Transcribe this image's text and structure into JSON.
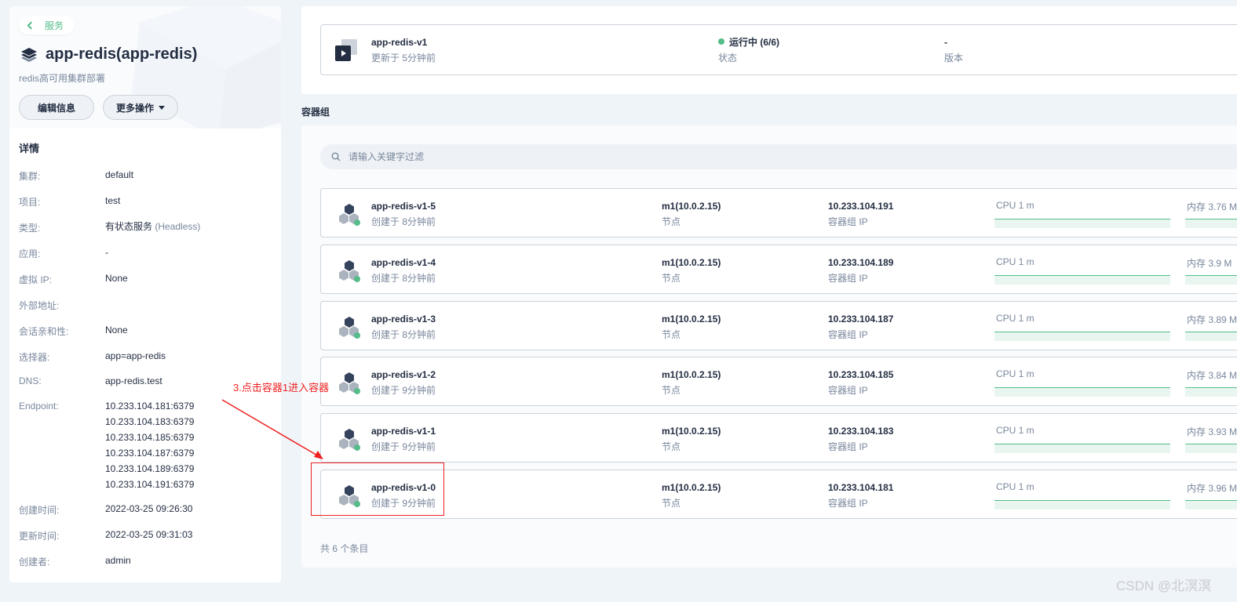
{
  "sidebar": {
    "back_label": "服务",
    "title": "app-redis(app-redis)",
    "subtitle": "redis高可用集群部署",
    "edit_button": "编辑信息",
    "more_button": "更多操作",
    "details_title": "详情",
    "details": [
      {
        "key": "集群:",
        "value": "default"
      },
      {
        "key": "项目:",
        "value": "test"
      },
      {
        "key": "类型:",
        "value": "有状态服务",
        "extra": "(Headless)"
      },
      {
        "key": "应用:",
        "value": "-"
      },
      {
        "key": "虚拟 IP:",
        "value": "None"
      },
      {
        "key": "外部地址:",
        "value": ""
      },
      {
        "key": "会话亲和性:",
        "value": "None"
      },
      {
        "key": "选择器:",
        "value": "app=app-redis"
      },
      {
        "key": "DNS:",
        "value": "app-redis.test"
      },
      {
        "key": "Endpoint:",
        "lines": [
          "10.233.104.181:6379",
          "10.233.104.183:6379",
          "10.233.104.185:6379",
          "10.233.104.187:6379",
          "10.233.104.189:6379",
          "10.233.104.191:6379"
        ]
      },
      {
        "key": "创建时间:",
        "value": "2022-03-25 09:26:30"
      },
      {
        "key": "更新时间:",
        "value": "2022-03-25 09:31:03"
      },
      {
        "key": "创建者:",
        "value": "admin"
      }
    ]
  },
  "workload": {
    "name": "app-redis-v1",
    "updated": "更新于 5分钟前",
    "status": "运行中 (6/6)",
    "status_label": "状态",
    "version": "-",
    "version_label": "版本"
  },
  "pods_section": {
    "title": "容器组",
    "search_placeholder": "请输入关键字过滤",
    "node_label": "节点",
    "ip_label": "容器组 IP",
    "pods": [
      {
        "name": "app-redis-v1-5",
        "created": "创建于 8分钟前",
        "node": "m1(10.0.2.15)",
        "ip": "10.233.104.191",
        "cpu": "CPU 1 m",
        "mem": "内存 3.76 M"
      },
      {
        "name": "app-redis-v1-4",
        "created": "创建于 8分钟前",
        "node": "m1(10.0.2.15)",
        "ip": "10.233.104.189",
        "cpu": "CPU 1 m",
        "mem": "内存 3.9 M"
      },
      {
        "name": "app-redis-v1-3",
        "created": "创建于 8分钟前",
        "node": "m1(10.0.2.15)",
        "ip": "10.233.104.187",
        "cpu": "CPU 1 m",
        "mem": "内存 3.89 M"
      },
      {
        "name": "app-redis-v1-2",
        "created": "创建于 9分钟前",
        "node": "m1(10.0.2.15)",
        "ip": "10.233.104.185",
        "cpu": "CPU 1 m",
        "mem": "内存 3.84 M"
      },
      {
        "name": "app-redis-v1-1",
        "created": "创建于 9分钟前",
        "node": "m1(10.0.2.15)",
        "ip": "10.233.104.183",
        "cpu": "CPU 1 m",
        "mem": "内存 3.93 M"
      },
      {
        "name": "app-redis-v1-0",
        "created": "创建于 9分钟前",
        "node": "m1(10.0.2.15)",
        "ip": "10.233.104.181",
        "cpu": "CPU 1 m",
        "mem": "内存 3.96 M"
      }
    ],
    "total": "共 6 个条目"
  },
  "annotation": {
    "text": "3.点击容器1进入容器",
    "color": "#ee1f1f"
  },
  "watermark": "CSDN @北溟溟",
  "colors": {
    "accent": "#55bc8a",
    "text": "#242e42",
    "muted": "#79879c",
    "border": "#ccd3db"
  }
}
